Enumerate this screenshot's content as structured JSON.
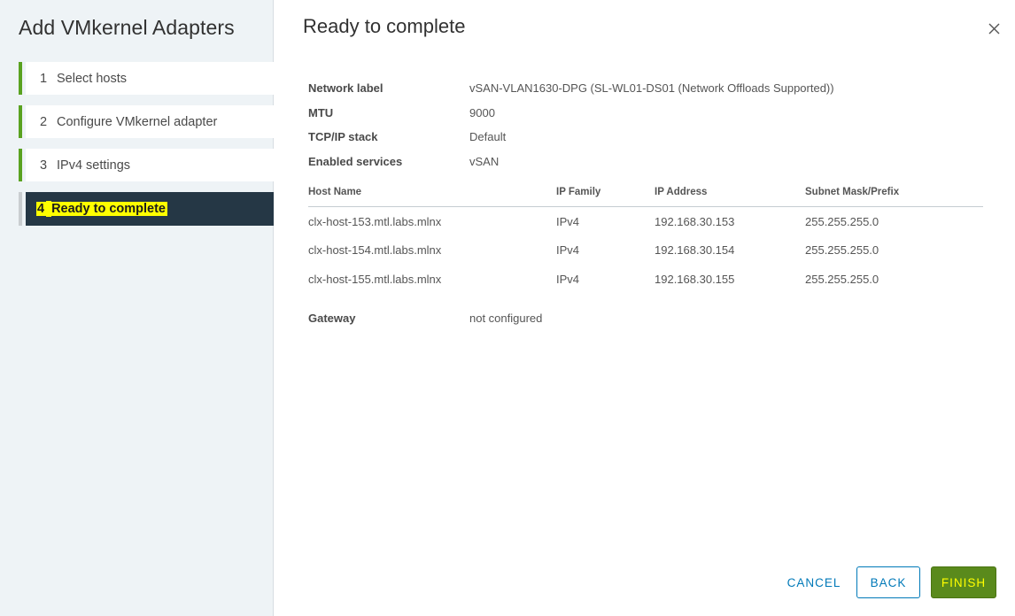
{
  "wizard": {
    "title": "Add VMkernel Adapters",
    "steps": [
      {
        "num": "1",
        "label": "Select hosts"
      },
      {
        "num": "2",
        "label": "Configure VMkernel adapter"
      },
      {
        "num": "3",
        "label": "IPv4 settings"
      },
      {
        "num": "4",
        "label": "Ready to complete"
      }
    ]
  },
  "page": {
    "title": "Ready to complete"
  },
  "summary": {
    "network_label": {
      "key": "Network label",
      "value": "vSAN-VLAN1630-DPG (SL-WL01-DS01 (Network Offloads Supported))"
    },
    "mtu": {
      "key": "MTU",
      "value": "9000"
    },
    "tcpip_stack": {
      "key": "TCP/IP stack",
      "value": "Default"
    },
    "enabled_services": {
      "key": "Enabled services",
      "value": "vSAN"
    }
  },
  "hosts_table": {
    "headers": [
      "Host Name",
      "IP Family",
      "IP Address",
      "Subnet Mask/Prefix"
    ],
    "rows": [
      [
        "clx-host-153.mtl.labs.mlnx",
        "IPv4",
        "192.168.30.153",
        "255.255.255.0"
      ],
      [
        "clx-host-154.mtl.labs.mlnx",
        "IPv4",
        "192.168.30.154",
        "255.255.255.0"
      ],
      [
        "clx-host-155.mtl.labs.mlnx",
        "IPv4",
        "192.168.30.155",
        "255.255.255.0"
      ]
    ]
  },
  "gateway": {
    "key": "Gateway",
    "value": "not configured"
  },
  "buttons": {
    "cancel": "CANCEL",
    "back": "BACK",
    "finish": "FINISH"
  },
  "colors": {
    "accent_blue": "#0079b8",
    "step_complete": "#5aa220",
    "current_step_bg": "#253745",
    "highlight": "#ffff00",
    "finish_bg": "#5a8a1c"
  },
  "icons": {
    "close": "close-icon"
  }
}
